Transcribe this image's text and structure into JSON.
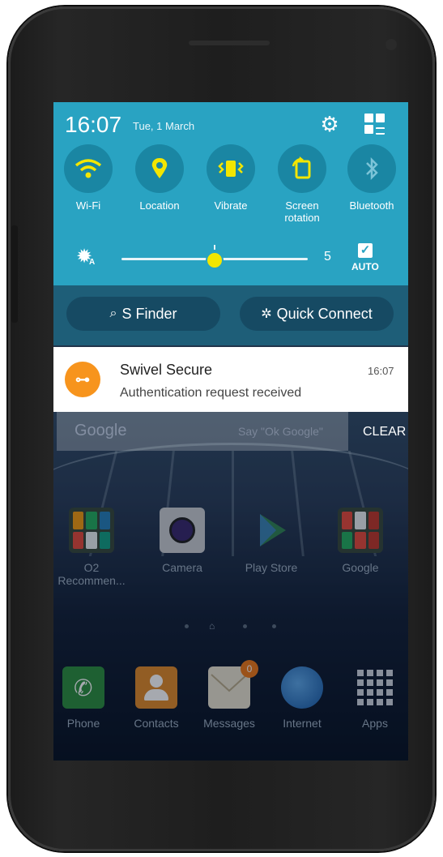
{
  "status": {
    "time": "16:07",
    "date": "Tue, 1 March"
  },
  "quick_settings": [
    {
      "label": "Wi-Fi",
      "icon": "wifi-icon"
    },
    {
      "label": "Location",
      "icon": "location-icon"
    },
    {
      "label": "Vibrate",
      "icon": "vibrate-icon"
    },
    {
      "label": "Screen rotation",
      "label_l1": "Screen",
      "label_l2": "rotation",
      "icon": "screen-rotation-icon"
    },
    {
      "label": "Bluetooth",
      "icon": "bluetooth-icon"
    }
  ],
  "brightness": {
    "value": "5",
    "auto_label": "AUTO",
    "auto_checked": true,
    "level_fraction": 0.5
  },
  "shortcuts": {
    "s_finder": "S Finder",
    "quick_connect": "Quick Connect"
  },
  "notification": {
    "app": "Swivel Secure",
    "message": "Authentication request received",
    "time": "16:07"
  },
  "clear_label": "CLEAR",
  "google_bar": {
    "logo": "Google",
    "hint": "Say \"Ok Google\""
  },
  "home_apps": [
    {
      "label": "O2 Recommen...",
      "l1": "O2",
      "l2": "Recommen..."
    },
    {
      "label": "Camera"
    },
    {
      "label": "Play Store"
    },
    {
      "label": "Google"
    }
  ],
  "dock_apps": [
    {
      "label": "Phone"
    },
    {
      "label": "Contacts"
    },
    {
      "label": "Messages",
      "badge": "0"
    },
    {
      "label": "Internet"
    },
    {
      "label": "Apps"
    }
  ],
  "colors": {
    "panel": "#29a3c2",
    "toggle_active": "#f3e600",
    "notif_icon": "#f7941d"
  }
}
